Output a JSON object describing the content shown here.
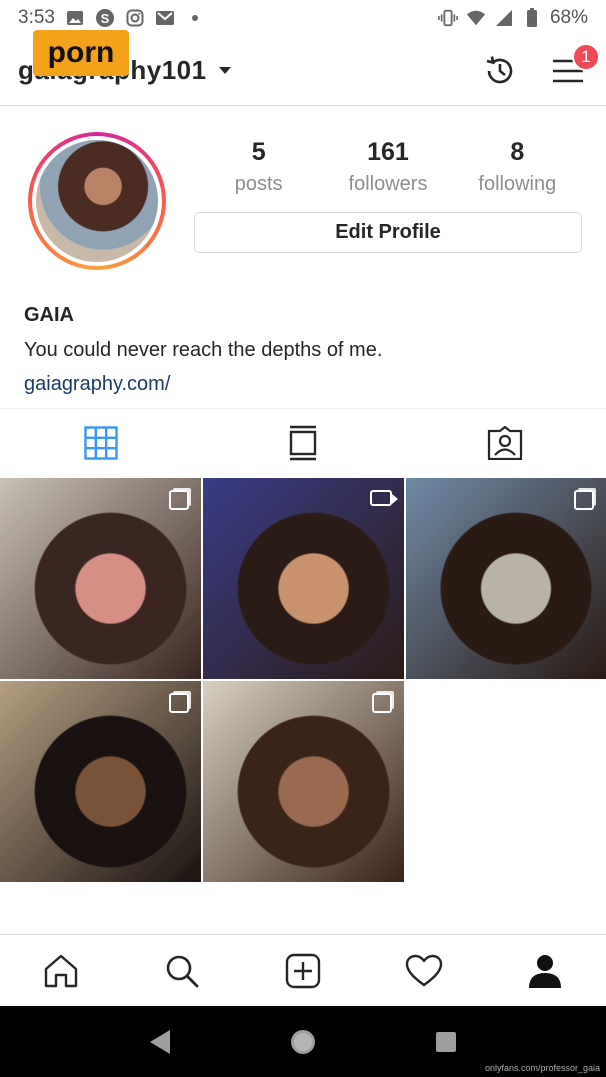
{
  "status_bar": {
    "time": "3:53",
    "battery": "68%"
  },
  "header": {
    "username": "gaiagraphy101",
    "watermark": "porn",
    "notification_count": "1"
  },
  "profile": {
    "stats": [
      {
        "value": "5",
        "label": "posts"
      },
      {
        "value": "161",
        "label": "followers"
      },
      {
        "value": "8",
        "label": "following"
      }
    ],
    "edit_profile_label": "Edit Profile",
    "name": "GAIA",
    "bio": "You could never reach the depths of me.",
    "website": "gaiagraphy.com/"
  },
  "tabs": [
    "grid-icon",
    "feed-icon",
    "tagged-icon"
  ],
  "posts": [
    {
      "type": "carousel",
      "colors": [
        "#c9c1b6",
        "#3a2620",
        "#d58f85"
      ]
    },
    {
      "type": "video",
      "colors": [
        "#3a3d86",
        "#2b1b16",
        "#c9926e"
      ]
    },
    {
      "type": "carousel",
      "colors": [
        "#6f8aa6",
        "#2a1a14",
        "#b9b2a9"
      ]
    },
    {
      "type": "carousel",
      "colors": [
        "#b59e82",
        "#1a1210",
        "#7a5238"
      ]
    },
    {
      "type": "carousel",
      "colors": [
        "#d8d0c2",
        "#3a2418",
        "#9a6a50"
      ]
    }
  ],
  "bottom_nav": [
    "home-icon",
    "search-icon",
    "new-post-icon",
    "activity-icon",
    "profile-icon"
  ],
  "credit": "onlyfans.com/professor_gaia",
  "colors": {
    "accent_blue": "#3897f0",
    "badge_red": "#ed4956",
    "link": "#1b3a6b"
  }
}
